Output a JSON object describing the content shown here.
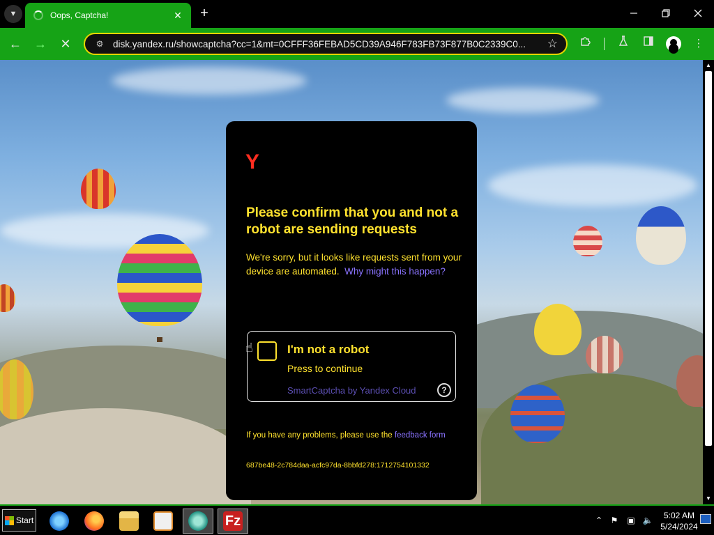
{
  "browser": {
    "tab_title": "Oops, Captcha!",
    "tab_close": "✕",
    "new_tab": "+",
    "url": "disk.yandex.ru/showcaptcha?cc=1&mt=0CFFF36FEBAD5CD39A946F783FB73F877B0C2339C0...",
    "accent_color": "#16a316",
    "omnibox_border_color": "#e6d600"
  },
  "captcha": {
    "logo": "Y",
    "title": "Please confirm that you and not a robot are sending requests",
    "description": "We're sorry, but it looks like requests sent from your device are automated.",
    "why_link": "Why might this happen?",
    "checkbox_label": "I'm not a robot",
    "checkbox_sub": "Press to continue",
    "provider": "SmartCaptcha by Yandex Cloud",
    "help_glyph": "?",
    "problems_text": "If you have any problems, please use the",
    "feedback_link": "feedback form",
    "request_id": "687be48-2c784daa-acfc97da-8bbfd278:1712754101332",
    "text_color": "#ffe22e",
    "link_color": "#8a73ff",
    "logo_color": "#ff2d20"
  },
  "taskbar": {
    "start_label": "Start",
    "apps": [
      "internet-explorer-icon",
      "firefox-icon",
      "file-explorer-icon",
      "media-player-icon",
      "chrome-app-icon",
      "filezilla-icon"
    ],
    "time": "5:02 AM",
    "date": "5/24/2024"
  }
}
